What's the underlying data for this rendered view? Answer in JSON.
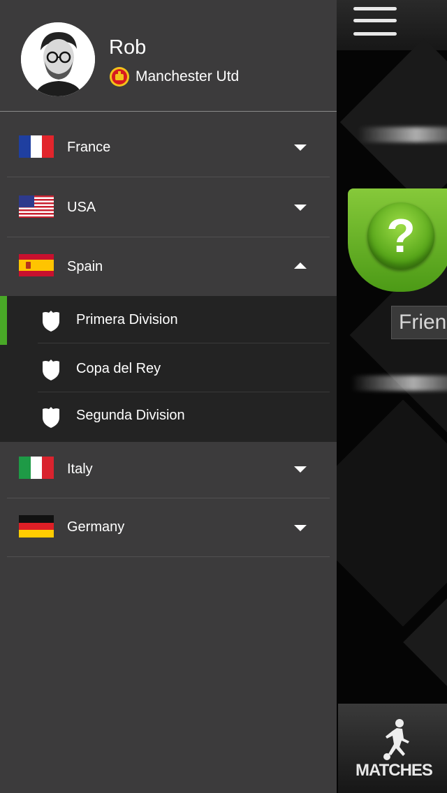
{
  "profile": {
    "name": "Rob",
    "team": "Manchester Utd"
  },
  "countries": [
    {
      "name": "France",
      "flag": "flag-france-icon",
      "expanded": false
    },
    {
      "name": "USA",
      "flag": "flag-usa-icon",
      "expanded": false
    },
    {
      "name": "Spain",
      "flag": "flag-spain-icon",
      "expanded": true
    },
    {
      "name": "Italy",
      "flag": "flag-italy-icon",
      "expanded": false
    },
    {
      "name": "Germany",
      "flag": "flag-germany-icon",
      "expanded": false
    }
  ],
  "spain_leagues": [
    {
      "name": "Primera Division",
      "selected": true
    },
    {
      "name": "Copa del Rey",
      "selected": false
    },
    {
      "name": "Segunda Division",
      "selected": false
    }
  ],
  "background": {
    "badge_symbol": "?",
    "badge_caption": "Frien",
    "bottom_tab_label": "MATCHES"
  },
  "colors": {
    "drawer": "#3c3b3c",
    "submenu": "#232323",
    "selection_accent": "#49a827",
    "badge_green": "#6cb52c"
  }
}
